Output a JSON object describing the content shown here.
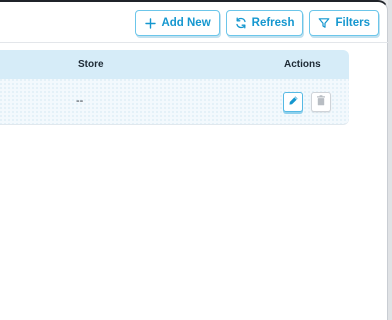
{
  "toolbar": {
    "add_new_label": "Add New",
    "refresh_label": "Refresh",
    "filters_label": "Filters"
  },
  "table": {
    "columns": [
      "Store",
      "Actions"
    ],
    "rows": [
      {
        "store": "--"
      }
    ]
  },
  "colors": {
    "accent": "#1597cf",
    "header_bg": "#d6ecf8",
    "row_bg": "#f3f9fd"
  },
  "icons": {
    "add": "plus-icon",
    "refresh": "refresh-icon",
    "filters": "filter-icon",
    "edit": "pencil-icon",
    "delete": "trash-icon"
  }
}
